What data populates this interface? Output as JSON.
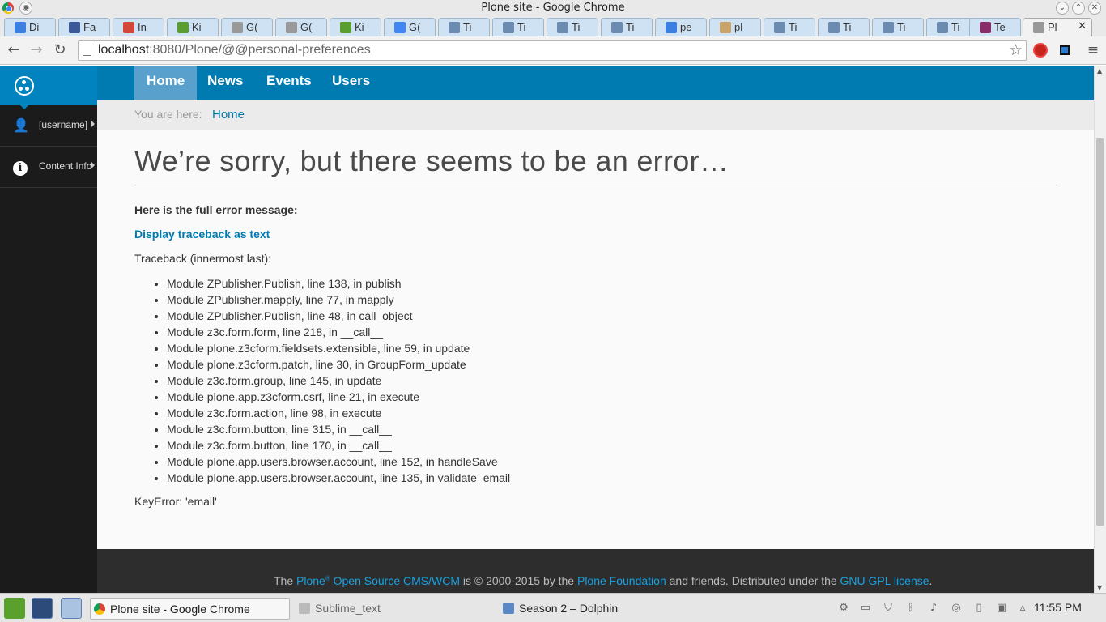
{
  "window": {
    "title": "Plone site - Google Chrome"
  },
  "tabs": [
    {
      "label": "Di",
      "icon": "google-plus-icon",
      "color": "#3b7fe0"
    },
    {
      "label": "Fa",
      "icon": "facebook-icon",
      "color": "#3b5998"
    },
    {
      "label": "In",
      "icon": "gmail-icon",
      "color": "#d44638"
    },
    {
      "label": "Ki",
      "icon": "leaf-icon",
      "color": "#5a9e2f"
    },
    {
      "label": "G(",
      "icon": "page-icon",
      "color": "#999999"
    },
    {
      "label": "G(",
      "icon": "page-icon",
      "color": "#999999"
    },
    {
      "label": "Ki",
      "icon": "leaf-icon",
      "color": "#5a9e2f"
    },
    {
      "label": "G(",
      "icon": "google-docs-icon",
      "color": "#4285f4"
    },
    {
      "label": "Ti",
      "icon": "tinymce-icon",
      "color": "#6b8bb0"
    },
    {
      "label": "Ti",
      "icon": "tinymce-icon",
      "color": "#6b8bb0"
    },
    {
      "label": "Ti",
      "icon": "tinymce-icon",
      "color": "#6b8bb0"
    },
    {
      "label": "Ti",
      "icon": "tinymce-icon",
      "color": "#6b8bb0"
    },
    {
      "label": "pe",
      "icon": "google-icon",
      "color": "#3b7fe0"
    },
    {
      "label": "pl",
      "icon": "puzzle-icon",
      "color": "#c8a46a"
    },
    {
      "label": "Ti",
      "icon": "tinymce-icon",
      "color": "#6b8bb0"
    },
    {
      "label": "Ti",
      "icon": "tinymce-icon",
      "color": "#6b8bb0"
    },
    {
      "label": "Ti",
      "icon": "tinymce-icon",
      "color": "#6b8bb0"
    },
    {
      "label": "Ti",
      "icon": "tinymce-icon",
      "color": "#6b8bb0"
    },
    {
      "label": "Te",
      "icon": "invision-icon",
      "color": "#8a2c6a"
    },
    {
      "label": "Pl",
      "icon": "page-icon",
      "color": "#999999",
      "active": true
    }
  ],
  "toolbar": {
    "url_host": "localhost",
    "url_rest": ":8080/Plone/@@personal-preferences"
  },
  "plone_toolbar": {
    "items": [
      {
        "label": "[username]",
        "icon": "user-icon"
      },
      {
        "label": "Content Info",
        "icon": "info-icon"
      }
    ]
  },
  "site_nav": {
    "items": [
      "Home",
      "News",
      "Events",
      "Users"
    ],
    "selected": 0
  },
  "breadcrumbs": {
    "label": "You are here:",
    "home": "Home"
  },
  "error": {
    "title": "We’re sorry, but there seems to be an error…",
    "full_message": "Here is the full error message:",
    "traceback_link": "Display traceback as text",
    "traceback_heading": "Traceback (innermost last):",
    "traceback": [
      "Module ZPublisher.Publish, line 138, in publish",
      "Module ZPublisher.mapply, line 77, in mapply",
      "Module ZPublisher.Publish, line 48, in call_object",
      "Module z3c.form.form, line 218, in __call__",
      "Module plone.z3cform.fieldsets.extensible, line 59, in update",
      "Module plone.z3cform.patch, line 30, in GroupForm_update",
      "Module z3c.form.group, line 145, in update",
      "Module plone.app.z3cform.csrf, line 21, in execute",
      "Module z3c.form.action, line 98, in execute",
      "Module z3c.form.button, line 315, in __call__",
      "Module z3c.form.button, line 170, in __call__",
      "Module plone.app.users.browser.account, line 152, in handleSave",
      "Module plone.app.users.browser.account, line 135, in validate_email"
    ],
    "key_error": "KeyError: 'email'"
  },
  "footer": {
    "the": "The ",
    "plone": "Plone",
    "reg": "®",
    "cms": " Open Source CMS/WCM",
    "is": " is ",
    "copy": "©",
    "years": " 2000-2015 by the ",
    "foundation": "Plone Foundation",
    "friends": " and friends. Distributed under the ",
    "license": "GNU GPL license",
    "end": "."
  },
  "taskbar": {
    "tasks": [
      {
        "label": "Plone site - Google Chrome",
        "active": true
      },
      {
        "label": "Sublime_text",
        "active": false
      },
      {
        "label": "Season 2 – Dolphin",
        "active": false
      }
    ],
    "clock": "11:55 PM"
  },
  "colors": {
    "plone_blue": "#007bb1",
    "nav_selected": "#59a0cc",
    "toolbar_dark": "#1b1b1b",
    "footer_dark": "#2d2d2d",
    "link": "#007bb1"
  }
}
